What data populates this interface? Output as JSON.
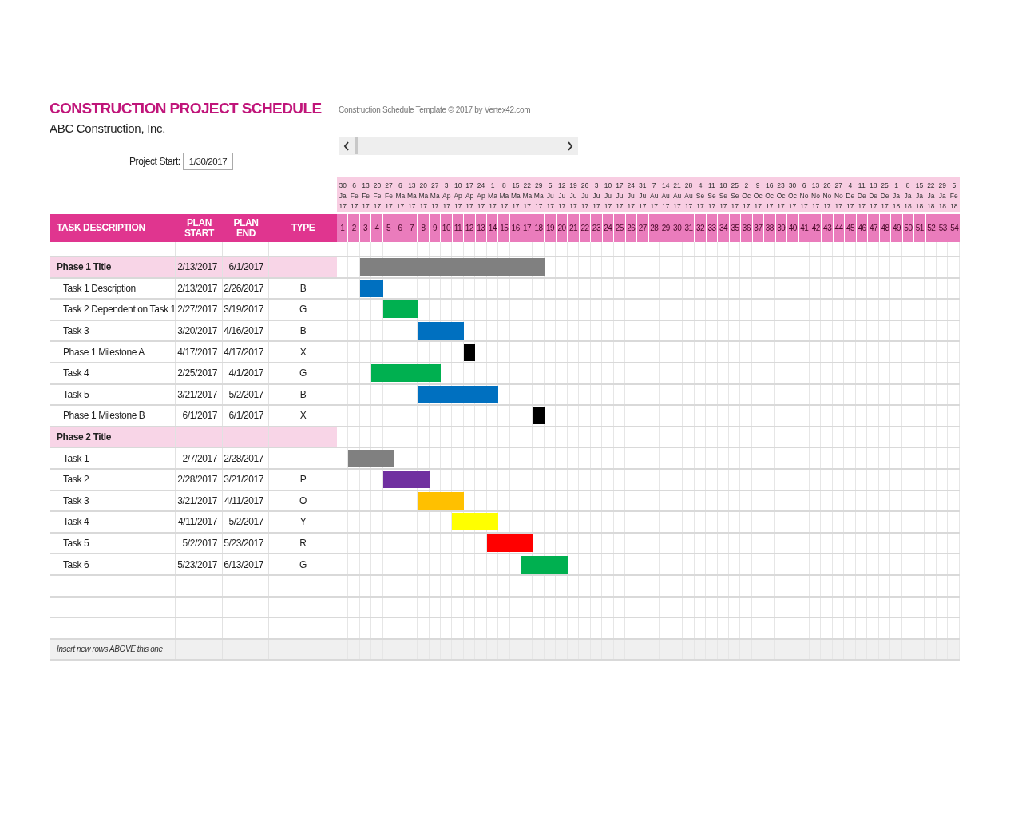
{
  "title": "CONSTRUCTION PROJECT SCHEDULE",
  "company": "ABC Construction, Inc.",
  "credit": "Construction Schedule Template © 2017 by Vertex42.com",
  "project_start": {
    "label": "Project Start:",
    "value": "1/30/2017"
  },
  "columns": [
    "TASK DESCRIPTION",
    "PLAN START",
    "PLAN END",
    "TYPE"
  ],
  "weeks": [
    {
      "day": "30",
      "month": "Ja",
      "year": "17",
      "number": "1"
    },
    {
      "day": "6",
      "month": "Fe",
      "year": "17",
      "number": "2"
    },
    {
      "day": "13",
      "month": "Fe",
      "year": "17",
      "number": "3"
    },
    {
      "day": "20",
      "month": "Fe",
      "year": "17",
      "number": "4"
    },
    {
      "day": "27",
      "month": "Fe",
      "year": "17",
      "number": "5"
    },
    {
      "day": "6",
      "month": "Ma",
      "year": "17",
      "number": "6"
    },
    {
      "day": "13",
      "month": "Ma",
      "year": "17",
      "number": "7"
    },
    {
      "day": "20",
      "month": "Ma",
      "year": "17",
      "number": "8"
    },
    {
      "day": "27",
      "month": "Ma",
      "year": "17",
      "number": "9"
    },
    {
      "day": "3",
      "month": "Ap",
      "year": "17",
      "number": "10"
    },
    {
      "day": "10",
      "month": "Ap",
      "year": "17",
      "number": "11"
    },
    {
      "day": "17",
      "month": "Ap",
      "year": "17",
      "number": "12"
    },
    {
      "day": "24",
      "month": "Ap",
      "year": "17",
      "number": "13"
    },
    {
      "day": "1",
      "month": "Ma",
      "year": "17",
      "number": "14"
    },
    {
      "day": "8",
      "month": "Ma",
      "year": "17",
      "number": "15"
    },
    {
      "day": "15",
      "month": "Ma",
      "year": "17",
      "number": "16"
    },
    {
      "day": "22",
      "month": "Ma",
      "year": "17",
      "number": "17"
    },
    {
      "day": "29",
      "month": "Ma",
      "year": "17",
      "number": "18"
    },
    {
      "day": "5",
      "month": "Ju",
      "year": "17",
      "number": "19"
    },
    {
      "day": "12",
      "month": "Ju",
      "year": "17",
      "number": "20"
    },
    {
      "day": "19",
      "month": "Ju",
      "year": "17",
      "number": "21"
    },
    {
      "day": "26",
      "month": "Ju",
      "year": "17",
      "number": "22"
    },
    {
      "day": "3",
      "month": "Ju",
      "year": "17",
      "number": "23"
    },
    {
      "day": "10",
      "month": "Ju",
      "year": "17",
      "number": "24"
    },
    {
      "day": "17",
      "month": "Ju",
      "year": "17",
      "number": "25"
    },
    {
      "day": "24",
      "month": "Ju",
      "year": "17",
      "number": "26"
    },
    {
      "day": "31",
      "month": "Ju",
      "year": "17",
      "number": "27"
    },
    {
      "day": "7",
      "month": "Au",
      "year": "17",
      "number": "28"
    },
    {
      "day": "14",
      "month": "Au",
      "year": "17",
      "number": "29"
    },
    {
      "day": "21",
      "month": "Au",
      "year": "17",
      "number": "30"
    },
    {
      "day": "28",
      "month": "Au",
      "year": "17",
      "number": "31"
    },
    {
      "day": "4",
      "month": "Se",
      "year": "17",
      "number": "32"
    },
    {
      "day": "11",
      "month": "Se",
      "year": "17",
      "number": "33"
    },
    {
      "day": "18",
      "month": "Se",
      "year": "17",
      "number": "34"
    },
    {
      "day": "25",
      "month": "Se",
      "year": "17",
      "number": "35"
    },
    {
      "day": "2",
      "month": "Oc",
      "year": "17",
      "number": "36"
    },
    {
      "day": "9",
      "month": "Oc",
      "year": "17",
      "number": "37"
    },
    {
      "day": "16",
      "month": "Oc",
      "year": "17",
      "number": "38"
    },
    {
      "day": "23",
      "month": "Oc",
      "year": "17",
      "number": "39"
    },
    {
      "day": "30",
      "month": "Oc",
      "year": "17",
      "number": "40"
    },
    {
      "day": "6",
      "month": "No",
      "year": "17",
      "number": "41"
    },
    {
      "day": "13",
      "month": "No",
      "year": "17",
      "number": "42"
    },
    {
      "day": "20",
      "month": "No",
      "year": "17",
      "number": "43"
    },
    {
      "day": "27",
      "month": "No",
      "year": "17",
      "number": "44"
    },
    {
      "day": "4",
      "month": "De",
      "year": "17",
      "number": "45"
    },
    {
      "day": "11",
      "month": "De",
      "year": "17",
      "number": "46"
    },
    {
      "day": "18",
      "month": "De",
      "year": "17",
      "number": "47"
    },
    {
      "day": "25",
      "month": "De",
      "year": "17",
      "number": "48"
    },
    {
      "day": "1",
      "month": "Ja",
      "year": "18",
      "number": "49"
    },
    {
      "day": "8",
      "month": "Ja",
      "year": "18",
      "number": "50"
    },
    {
      "day": "15",
      "month": "Ja",
      "year": "18",
      "number": "51"
    },
    {
      "day": "22",
      "month": "Ja",
      "year": "18",
      "number": "52"
    },
    {
      "day": "29",
      "month": "Ja",
      "year": "18",
      "number": "53"
    },
    {
      "day": "5",
      "month": "Fe",
      "year": "18",
      "number": "54"
    }
  ],
  "rows": [
    {
      "kind": "phase",
      "task": "Phase 1 Title",
      "start": "2/13/2017",
      "end": "6/1/2017"
    },
    {
      "kind": "task",
      "task": "Task 1 Description",
      "start": "2/13/2017",
      "end": "2/26/2017",
      "type": "B"
    },
    {
      "kind": "task",
      "task": "Task 2 Dependent on Task 1",
      "start": "2/27/2017",
      "end": "3/19/2017",
      "type": "G"
    },
    {
      "kind": "task",
      "task": "Task 3",
      "start": "3/20/2017",
      "end": "4/16/2017",
      "type": "B"
    },
    {
      "kind": "task",
      "task": "Phase 1 Milestone A",
      "start": "4/17/2017",
      "end": "4/17/2017",
      "type": "X"
    },
    {
      "kind": "task",
      "task": "Task 4",
      "start": "2/25/2017",
      "end": "4/1/2017",
      "type": "G"
    },
    {
      "kind": "task",
      "task": "Task 5",
      "start": "3/21/2017",
      "end": "5/2/2017",
      "type": "B"
    },
    {
      "kind": "task",
      "task": "Phase 1 Milestone B",
      "start": "6/1/2017",
      "end": "6/1/2017",
      "type": "X"
    },
    {
      "kind": "phase",
      "task": "Phase 2 Title"
    },
    {
      "kind": "task",
      "task": "Task 1",
      "start": "2/7/2017",
      "end": "2/28/2017"
    },
    {
      "kind": "task",
      "task": "Task 2",
      "start": "2/28/2017",
      "end": "3/21/2017",
      "type": "P"
    },
    {
      "kind": "task",
      "task": "Task 3",
      "start": "3/21/2017",
      "end": "4/11/2017",
      "type": "O"
    },
    {
      "kind": "task",
      "task": "Task 4",
      "start": "4/11/2017",
      "end": "5/2/2017",
      "type": "Y"
    },
    {
      "kind": "task",
      "task": "Task 5",
      "start": "5/2/2017",
      "end": "5/23/2017",
      "type": "R"
    },
    {
      "kind": "task",
      "task": "Task 6",
      "start": "5/23/2017",
      "end": "6/13/2017",
      "type": "G"
    }
  ],
  "footer_note": "Insert new rows ABOVE this one"
}
